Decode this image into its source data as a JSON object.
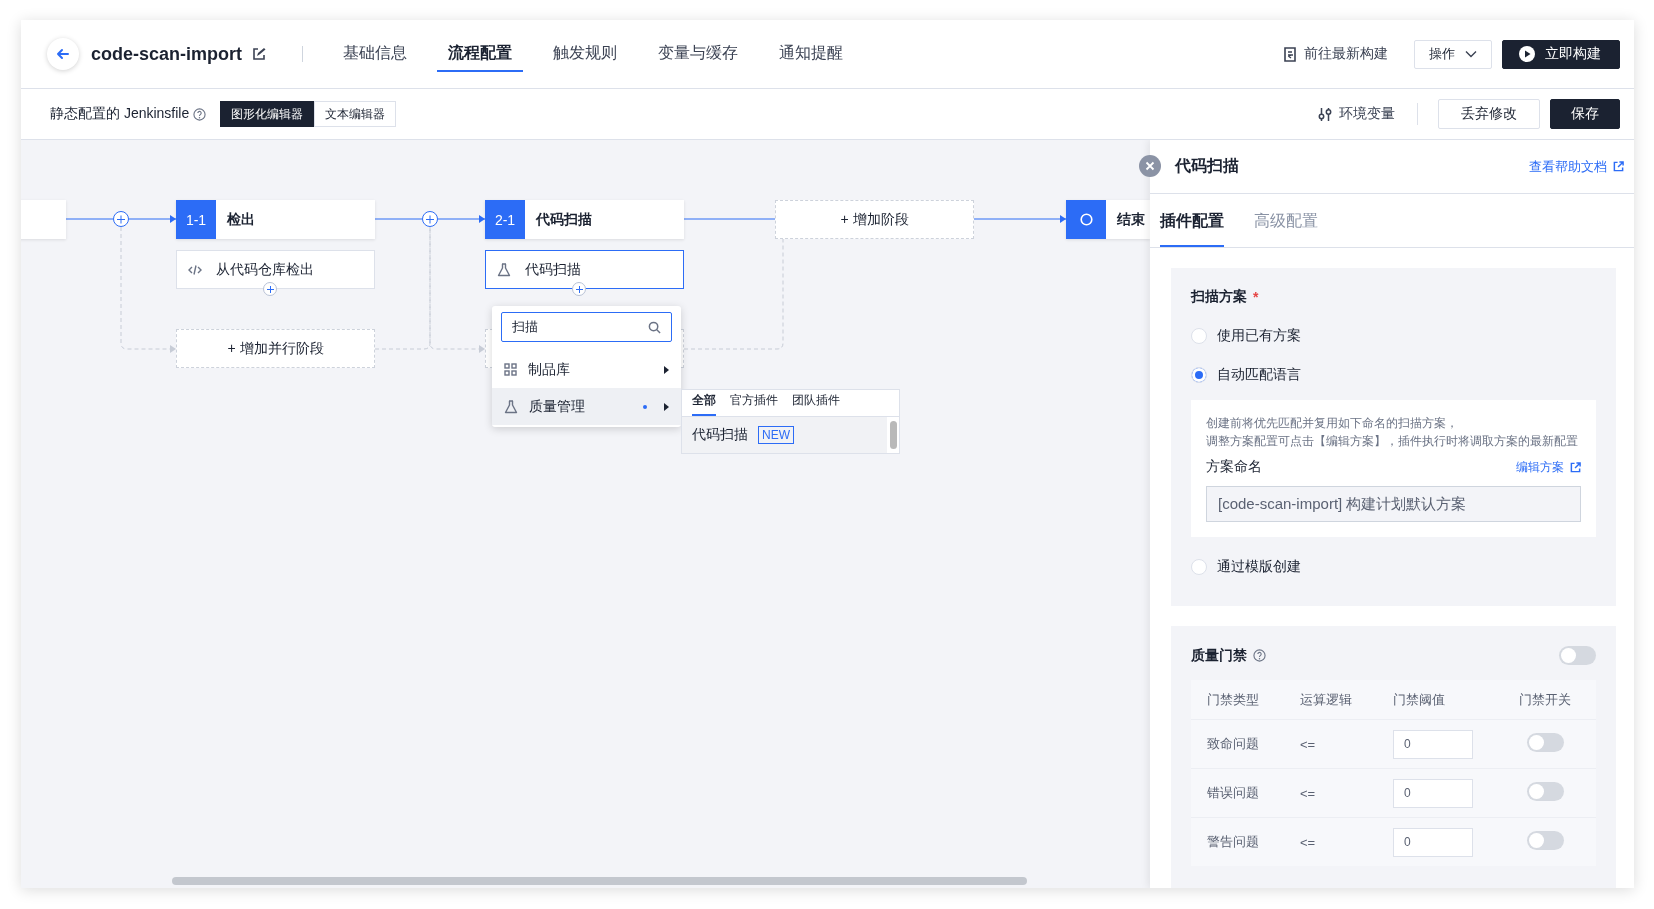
{
  "header": {
    "title": "code-scan-import",
    "tabs": [
      {
        "label": "基础信息",
        "selected": false
      },
      {
        "label": "流程配置",
        "selected": true
      },
      {
        "label": "触发规则",
        "selected": false
      },
      {
        "label": "变量与缓存",
        "selected": false
      },
      {
        "label": "通知提醒",
        "selected": false
      }
    ],
    "latest_build": "前往最新构建",
    "operate": "操作",
    "build_now": "立即构建"
  },
  "toolbar": {
    "label": "静态配置的 Jenkinsfile",
    "editor_modes": [
      {
        "label": "图形化编辑器",
        "selected": true
      },
      {
        "label": "文本编辑器",
        "selected": false
      }
    ],
    "env_vars": "环境变量",
    "discard": "丢弃修改",
    "save": "保存"
  },
  "pipeline": {
    "stages": [
      {
        "index": "1-1",
        "name": "检出",
        "steps": [
          {
            "name": "从代码仓库检出",
            "kind": "code",
            "selected": false
          }
        ],
        "add_parallel": "+ 增加并行阶段"
      },
      {
        "index": "2-1",
        "name": "代码扫描",
        "steps": [
          {
            "name": "代码扫描",
            "kind": "flask",
            "selected": true
          }
        ]
      }
    ],
    "add_stage": "+ 增加阶段",
    "end": "结束"
  },
  "plugin_picker": {
    "search": "扫描",
    "categories": [
      {
        "label": "制品库",
        "kind": "grid",
        "selected": false,
        "marked": false
      },
      {
        "label": "质量管理",
        "kind": "flask",
        "selected": true,
        "marked": true
      }
    ],
    "submenu": {
      "tabs": [
        {
          "label": "全部",
          "selected": true
        },
        {
          "label": "官方插件",
          "selected": false
        },
        {
          "label": "团队插件",
          "selected": false
        }
      ],
      "items": [
        {
          "name": "代码扫描",
          "badge": "NEW",
          "selected": true
        }
      ]
    }
  },
  "panel": {
    "title": "代码扫描",
    "help_link": "查看帮助文档",
    "tabs": [
      {
        "label": "插件配置",
        "selected": true
      },
      {
        "label": "高级配置",
        "selected": false
      }
    ],
    "scheme": {
      "label": "扫描方案",
      "required_mark": "*",
      "options": [
        {
          "label": "使用已有方案",
          "selected": false
        },
        {
          "label": "自动匹配语言",
          "selected": true,
          "detail": {
            "hint_lines": [
              "创建前将优先匹配并复用如下命名的扫描方案，",
              "调整方案配置可点击【编辑方案】，插件执行时将调取方案的最新配置"
            ],
            "name_label": "方案命名",
            "edit_link": "编辑方案",
            "name_value": "[code-scan-import] 构建计划默认方案"
          }
        },
        {
          "label": "通过模版创建",
          "selected": false
        }
      ]
    },
    "quality_gate": {
      "label": "质量门禁",
      "on": false,
      "columns": [
        "门禁类型",
        "运算逻辑",
        "门禁阈值",
        "门禁开关"
      ],
      "rows": [
        {
          "type": "致命问题",
          "operator": "<=",
          "threshold": "0",
          "on": false
        },
        {
          "type": "错误问题",
          "operator": "<=",
          "threshold": "0",
          "on": false
        },
        {
          "type": "警告问题",
          "operator": "<=",
          "threshold": "0",
          "on": false
        }
      ]
    }
  }
}
